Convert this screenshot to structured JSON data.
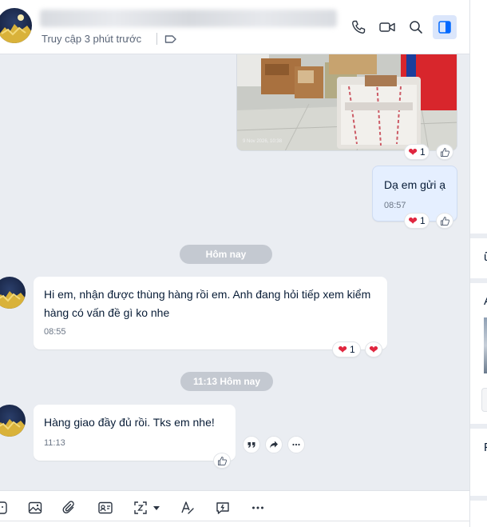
{
  "header": {
    "last_seen": "Truy cập 3 phút trước",
    "icons": [
      "phone-icon",
      "video-call-icon",
      "search-icon",
      "sidebar-toggle-icon"
    ]
  },
  "messages": {
    "photo_caption": "9 Nov 2026, 10:38",
    "sent_text": "Dạ em gửi ạ",
    "sent_time": "08:57",
    "photo_reaction_count": "1",
    "sent_reaction_count": "1",
    "date_divider_1": "Hôm nay",
    "incoming_1_text": "Hi em, nhận được thùng hàng rồi em. Anh đang hỏi tiếp xem kiểm hàng có vấn đề gì ko nhe",
    "incoming_1_time": "08:55",
    "incoming_1_reaction_count": "1",
    "date_divider_2": "11:13 Hôm nay",
    "incoming_2_text": "Hàng giao đầy đủ rồi. Tks em nhe!",
    "incoming_2_time": "11:13"
  },
  "right_panel": {
    "glyph_1": "ữ",
    "glyph_2": "A",
    "glyph_3": "F"
  },
  "colors": {
    "accent": "#0068ff",
    "heart": "#e0263f",
    "chat_bg": "#eaedf2",
    "my_bubble": "#e5efff"
  }
}
